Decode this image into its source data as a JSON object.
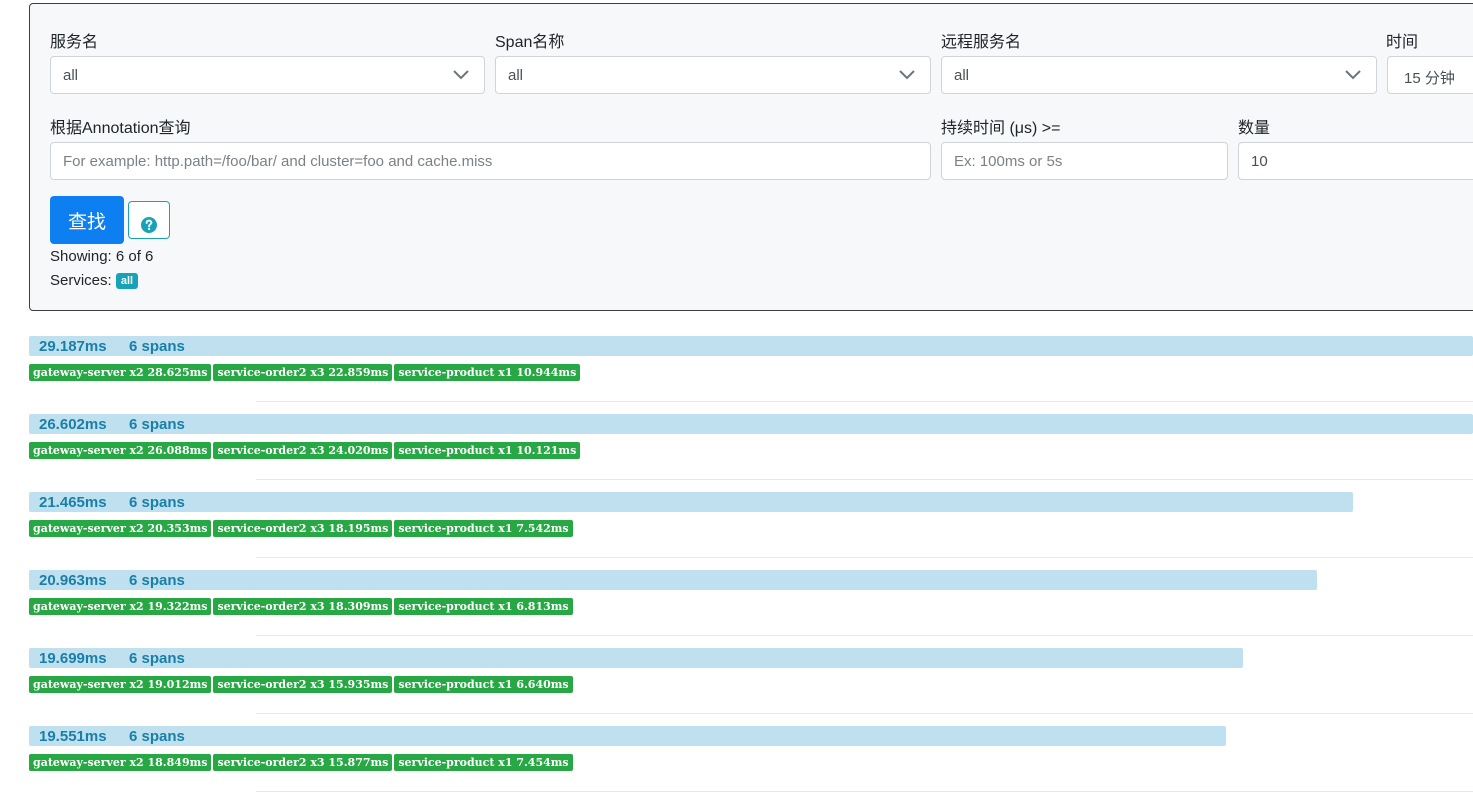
{
  "filters": {
    "service_label": "服务名",
    "service_value": "all",
    "span_label": "Span名称",
    "span_value": "all",
    "remote_label": "远程服务名",
    "remote_value": "all",
    "time_label": "时间",
    "time_value": "15 分钟",
    "annotation_label": "根据Annotation查询",
    "annotation_placeholder": "For example: http.path=/foo/bar/ and cluster=foo and cache.miss",
    "duration_label": "持续时间 (μs) >=",
    "duration_placeholder": "Ex: 100ms or 5s",
    "limit_label": "数量",
    "limit_value": "10",
    "search_button": "查找",
    "help_icon": "question-circle-icon"
  },
  "summary": {
    "showing": "Showing: 6 of 6",
    "services_label": "Services:",
    "services_badge": "all"
  },
  "colors": {
    "primary": "#0d7ff0",
    "info": "#17a2b8",
    "success": "#28a745",
    "trace_bar": "#bfe0ee",
    "trace_text": "#1a7fa8"
  },
  "traces": [
    {
      "duration": "29.187ms",
      "spans": "6 spans",
      "relative_length": 1.0,
      "tags": [
        "gateway-server x2 28.625ms",
        "service-order2 x3 22.859ms",
        "service-product x1 10.944ms"
      ]
    },
    {
      "duration": "26.602ms",
      "spans": "6 spans",
      "relative_length": 1.0,
      "tags": [
        "gateway-server x2 26.088ms",
        "service-order2 x3 24.020ms",
        "service-product x1 10.121ms"
      ]
    },
    {
      "duration": "21.465ms",
      "spans": "6 spans",
      "relative_length": 0.917,
      "tags": [
        "gateway-server x2 20.353ms",
        "service-order2 x3 18.195ms",
        "service-product x1 7.542ms"
      ]
    },
    {
      "duration": "20.963ms",
      "spans": "6 spans",
      "relative_length": 0.892,
      "tags": [
        "gateway-server x2 19.322ms",
        "service-order2 x3 18.309ms",
        "service-product x1 6.813ms"
      ]
    },
    {
      "duration": "19.699ms",
      "spans": "6 spans",
      "relative_length": 0.841,
      "tags": [
        "gateway-server x2 19.012ms",
        "service-order2 x3 15.935ms",
        "service-product x1 6.640ms"
      ]
    },
    {
      "duration": "19.551ms",
      "spans": "6 spans",
      "relative_length": 0.829,
      "tags": [
        "gateway-server x2 18.849ms",
        "service-order2 x3 15.877ms",
        "service-product x1 7.454ms"
      ]
    }
  ]
}
